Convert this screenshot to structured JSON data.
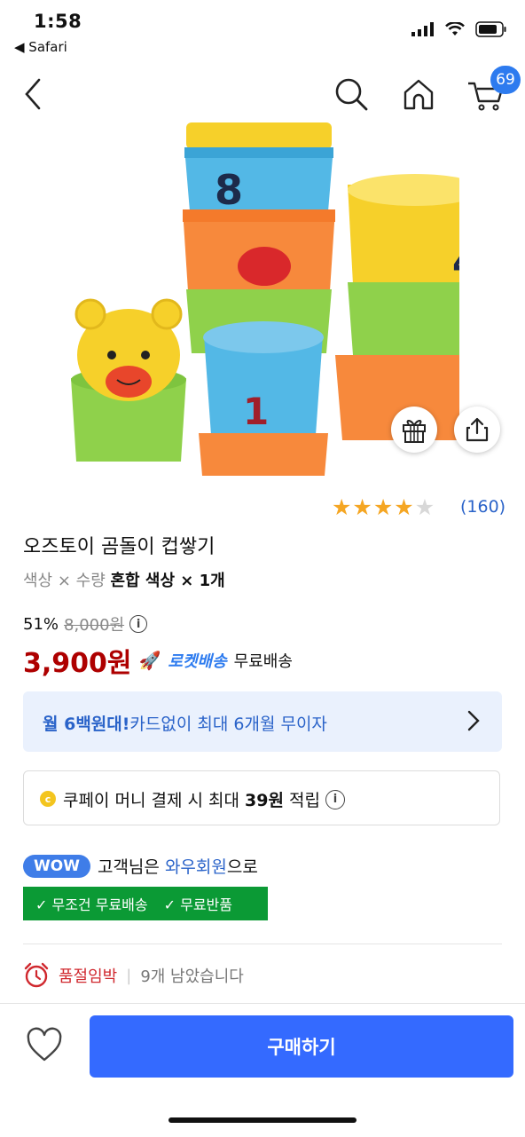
{
  "status_bar": {
    "time": "1:58",
    "back_app": "◀ Safari"
  },
  "nav": {
    "cart_count": "69"
  },
  "rating": {
    "stars_filled": 4,
    "stars_total": 5,
    "count": "(160)"
  },
  "product": {
    "title": "오즈토이 곰돌이 컵쌓기",
    "option_label": "색상 × 수량",
    "option_value": "혼합 색상 × 1개"
  },
  "price": {
    "discount": "51%",
    "original": "8,000원",
    "sale": "3,900원",
    "rocket": "로켓배송",
    "shipping": "무료배송"
  },
  "card_banner": {
    "text_bold": "월 6백원대!",
    "text": "카드없이 최대 6개월 무이자"
  },
  "coupay": {
    "prefix": "쿠페이 머니 결제 시 최대 ",
    "amount": "39원",
    "suffix": " 적립"
  },
  "wow": {
    "badge": "WOW",
    "text_before": "고객님은 ",
    "member": "와우회원",
    "text_after": "으로",
    "benefit_1": "✓ 무조건 무료배송",
    "benefit_2": "✓ 무료반품"
  },
  "stock": {
    "warning": "품절임박",
    "separator": "|",
    "remaining": "9개 남았습니다"
  },
  "bottom": {
    "buy_label": "구매하기"
  },
  "colors": {
    "accent_blue": "#346aff",
    "price_red": "#ae0000",
    "wow_green": "#0b9a35",
    "star_gold": "#f5a623"
  }
}
